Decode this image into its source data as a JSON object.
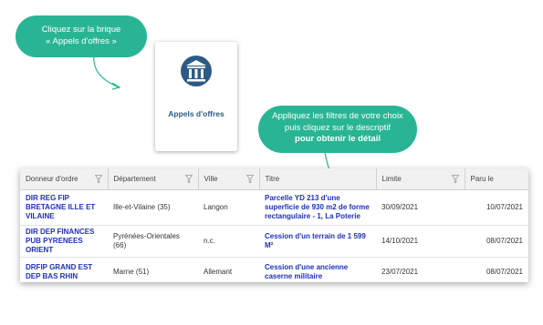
{
  "bubble_top": {
    "line1": "Cliquez sur la brique",
    "line2": "« Appels d'offres »"
  },
  "tile": {
    "label": "Appels d'offres",
    "icon": "institution-icon"
  },
  "bubble_right": {
    "line1": "Appliquez les filtres de votre choix",
    "line2": "puis cliquez sur le descriptif",
    "line3": "pour obtenir le détail"
  },
  "colors": {
    "accent": "#29b594",
    "link": "#1f2fbf",
    "tile_label": "#2b5b85"
  },
  "table": {
    "headers": [
      "Donneur d'ordre",
      "Département",
      "Ville",
      "Titre",
      "Limite",
      "Paru le"
    ],
    "rows": [
      {
        "donneur": "DIR REG FIP BRETAGNE ILLE ET VILAINE",
        "departement": "Ille-et-Vilaine (35)",
        "ville": "Langon",
        "titre": "Parcelle YD 213 d'une superficie de 930 m2 de forme rectangulaire - 1, La Poterie",
        "limite": "30/09/2021",
        "paru": "10/07/2021"
      },
      {
        "donneur": "DIR DEP FINANCES PUB PYRENEES ORIENT",
        "departement": "Pyrénées-Orientales (66)",
        "ville": "n.c.",
        "titre": "Cession d'un terrain de 1 599 M²",
        "limite": "14/10/2021",
        "paru": "08/07/2021"
      },
      {
        "donneur": "DRFIP GRAND EST DEP BAS RHIN",
        "departement": "Marne (51)",
        "ville": "Allemant",
        "titre": "Cession d'une ancienne caserne militaire",
        "limite": "23/07/2021",
        "paru": "08/07/2021"
      }
    ]
  }
}
